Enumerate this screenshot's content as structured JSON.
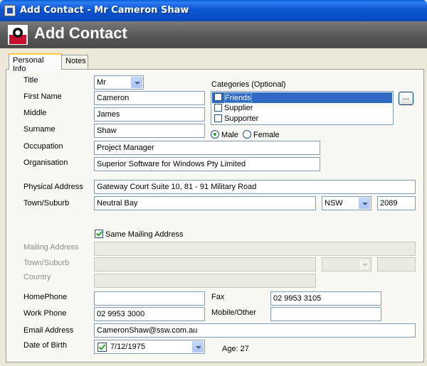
{
  "window": {
    "title": "Add Contact - Mr Cameron Shaw"
  },
  "banner": {
    "title": "Add Contact"
  },
  "tabs": [
    {
      "label": "Personal Info"
    },
    {
      "label": "Notes"
    }
  ],
  "form": {
    "title_label": "Title",
    "title_value": "Mr",
    "first_name_label": "First Name",
    "first_name": "Cameron",
    "middle_label": "Middle",
    "middle": "James",
    "surname_label": "Surname",
    "surname": "Shaw",
    "occupation_label": "Occupation",
    "occupation": "Project Manager",
    "organisation_label": "Organisation",
    "organisation": "Superior Software for Windows Pty Limited",
    "categories_label": "Categories (Optional)",
    "categories": [
      {
        "label": "Friends",
        "checked": false,
        "selected": true
      },
      {
        "label": "Supplier",
        "checked": false,
        "selected": false
      },
      {
        "label": "Supporter",
        "checked": false,
        "selected": false
      }
    ],
    "categories_button": "...",
    "gender_male": "Male",
    "gender_female": "Female",
    "gender_selected": "Male",
    "physical_address_label": "Physical Address",
    "physical_address": "Gateway Court Suite 10, 81 - 91 Military Road",
    "town_suburb_label": "Town/Suburb",
    "town_suburb": "Neutral Bay",
    "state": "NSW",
    "postcode": "2089",
    "same_mailing_label": "Same Mailing Address",
    "same_mailing_checked": true,
    "mailing_address_label": "Mailing Address",
    "mailing_address": "",
    "mailing_town_label": "Town/Suburb",
    "mailing_town": "",
    "mailing_state": "",
    "mailing_postcode": "",
    "country_label": "Country",
    "country": "",
    "home_phone_label": "HomePhone",
    "home_phone": "",
    "fax_label": "Fax",
    "fax": "02 9953 3105",
    "work_phone_label": "Work Phone",
    "work_phone": "02 9953 3000",
    "mobile_label": "Mobile/Other",
    "mobile": "",
    "email_label": "Email Address",
    "email": "CameronShaw@ssw.com.au",
    "dob_label": "Date of Birth",
    "dob": "7/12/1975",
    "dob_checked": true,
    "age_text": "Age: 27"
  },
  "colors": {
    "titlebar": "#0a4cc3",
    "selection": "#316ac5",
    "check": "#21a121",
    "tab_highlight": "#ffc83c"
  }
}
